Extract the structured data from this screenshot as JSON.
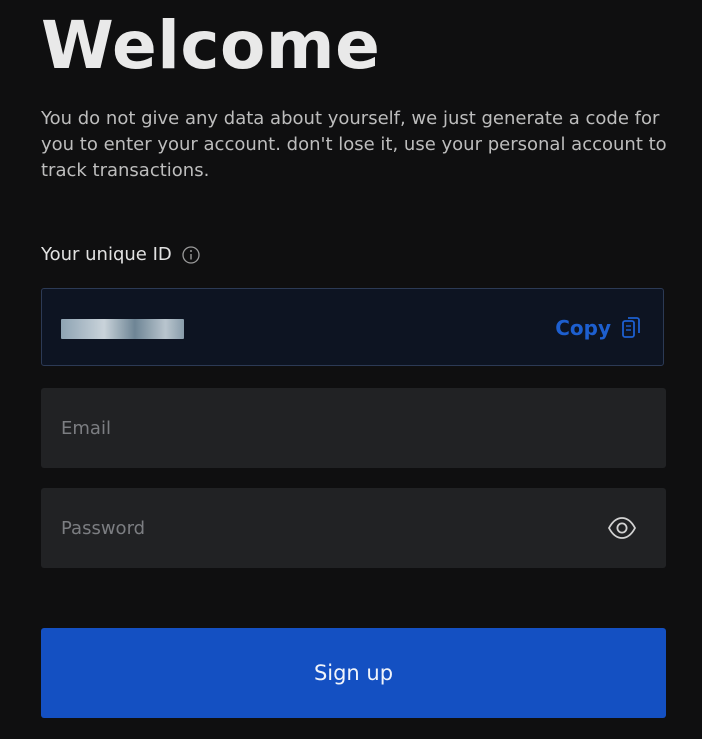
{
  "page": {
    "title": "Welcome",
    "subtitle": "You do not give any data about yourself, we just generate a code for you to enter your account. don't lose it, use your personal account to track transactions."
  },
  "unique_id": {
    "label": "Your unique ID",
    "info_icon": "info-icon",
    "value_state": "redacted",
    "copy_label": "Copy",
    "copy_icon": "clipboard-icon"
  },
  "form": {
    "email": {
      "placeholder": "Email",
      "value": ""
    },
    "password": {
      "placeholder": "Password",
      "value": "",
      "toggle_icon": "eye-icon"
    },
    "submit_label": "Sign up"
  },
  "colors": {
    "background": "#0f0f10",
    "field_background": "#212224",
    "id_box_background": "#0d1422",
    "id_box_border": "#2c3a55",
    "accent": "#1d5fcf",
    "button": "#1450c2"
  }
}
